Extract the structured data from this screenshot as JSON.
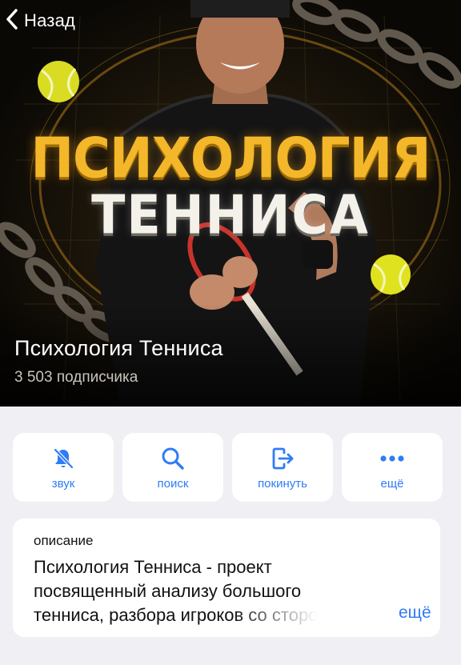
{
  "nav": {
    "back_label": "Назад"
  },
  "cover": {
    "poster_line1": "ПСИХОЛОГИЯ",
    "poster_line2": "ТЕННИСА",
    "channel_name": "Психология Тенниса",
    "subscribers": "3 503 подписчика"
  },
  "actions": [
    {
      "label": "звук",
      "icon": "bell-slash-icon"
    },
    {
      "label": "поиск",
      "icon": "search-icon"
    },
    {
      "label": "покинуть",
      "icon": "leave-icon"
    },
    {
      "label": "ещё",
      "icon": "more-icon"
    }
  ],
  "description": {
    "heading": "описание",
    "lines": [
      "Психология Тенниса - проект",
      "посвященный анализу большого",
      "тенниса, разбора игроков со сторо"
    ],
    "more_label": "ещё"
  },
  "colors": {
    "accent": "#2f7cf6",
    "poster_gold": "#f4b72a",
    "background": "#efeff4"
  }
}
